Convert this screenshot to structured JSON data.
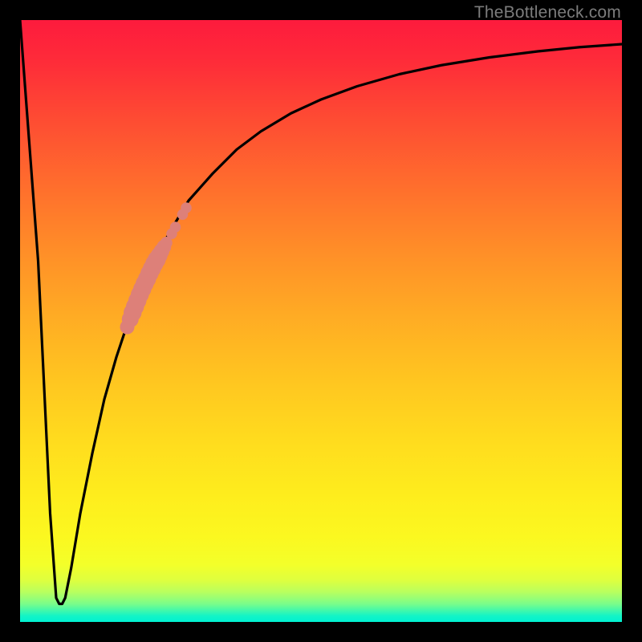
{
  "attribution": "TheBottleneck.com",
  "colors": {
    "page_bg": "#000000",
    "curve": "#000000",
    "points": "#dd8079",
    "gradient_top": "#fd1b3d",
    "gradient_bottom": "#00f1d2",
    "attribution_text": "#7c7c7c"
  },
  "chart_data": {
    "type": "line",
    "title": "",
    "xlabel": "",
    "ylabel": "",
    "xlim": [
      0,
      100
    ],
    "ylim": [
      0,
      100
    ],
    "series": [
      {
        "name": "bottleneck-curve",
        "x": [
          0,
          3,
          5,
          6,
          6.5,
          7,
          7.5,
          8.5,
          10,
          12,
          14,
          16,
          18,
          20,
          22,
          25,
          28,
          32,
          36,
          40,
          45,
          50,
          56,
          63,
          70,
          78,
          86,
          93,
          100
        ],
        "values": [
          100,
          60,
          18,
          4,
          3,
          3,
          4,
          9,
          18,
          28,
          37,
          44,
          50,
          55,
          59.5,
          65,
          70,
          74.5,
          78.5,
          81.5,
          84.5,
          86.8,
          89,
          91,
          92.5,
          93.8,
          94.8,
          95.5,
          96
        ]
      }
    ],
    "points": {
      "name": "highlighted-region",
      "color": "#dd8079",
      "data": [
        {
          "x": 17.8,
          "y": 49.0,
          "r": 1.2
        },
        {
          "x": 18.3,
          "y": 50.3,
          "r": 1.4
        },
        {
          "x": 18.7,
          "y": 51.4,
          "r": 1.5
        },
        {
          "x": 19.1,
          "y": 52.4,
          "r": 1.5
        },
        {
          "x": 19.5,
          "y": 53.4,
          "r": 1.5
        },
        {
          "x": 19.9,
          "y": 54.4,
          "r": 1.5
        },
        {
          "x": 20.3,
          "y": 55.3,
          "r": 1.5
        },
        {
          "x": 20.7,
          "y": 56.2,
          "r": 1.5
        },
        {
          "x": 21.1,
          "y": 57.0,
          "r": 1.5
        },
        {
          "x": 21.5,
          "y": 57.9,
          "r": 1.5
        },
        {
          "x": 21.9,
          "y": 58.7,
          "r": 1.5
        },
        {
          "x": 22.3,
          "y": 59.5,
          "r": 1.5
        },
        {
          "x": 22.7,
          "y": 60.2,
          "r": 1.5
        },
        {
          "x": 23.1,
          "y": 60.9,
          "r": 1.4
        },
        {
          "x": 23.5,
          "y": 61.6,
          "r": 1.3
        },
        {
          "x": 23.9,
          "y": 62.3,
          "r": 1.2
        },
        {
          "x": 24.3,
          "y": 63.0,
          "r": 1.0
        },
        {
          "x": 25.2,
          "y": 64.5,
          "r": 0.9
        },
        {
          "x": 25.8,
          "y": 65.6,
          "r": 0.9
        },
        {
          "x": 27.0,
          "y": 67.7,
          "r": 0.9
        },
        {
          "x": 27.6,
          "y": 68.8,
          "r": 0.9
        }
      ]
    }
  }
}
